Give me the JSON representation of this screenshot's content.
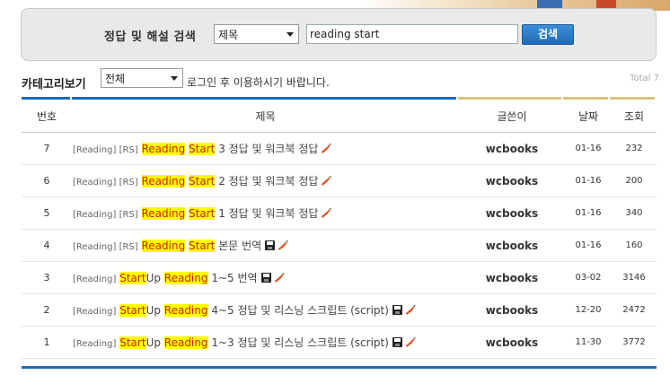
{
  "search": {
    "label": "정답 및 해설 검색",
    "field_selected": "제목",
    "query": "reading start",
    "button_label": "검색"
  },
  "category": {
    "label": "카테고리보기",
    "selected": "전체",
    "login_note": "로그인 후 이용하시기 바랍니다.",
    "total": "Total 7"
  },
  "table": {
    "headers": {
      "num": "번호",
      "title": "제목",
      "writer": "글쓴이",
      "date": "날짜",
      "views": "조회"
    },
    "rows": [
      {
        "num": "7",
        "tag": "[Reading] [RS]",
        "parts": [
          " ",
          "Reading",
          " ",
          "Start",
          " 3 정답 및 워크북 정답"
        ],
        "hl": [
          1,
          3
        ],
        "disk": false,
        "writer": "wcbooks",
        "date": "01-16",
        "views": "232"
      },
      {
        "num": "6",
        "tag": "[Reading] [RS]",
        "parts": [
          " ",
          "Reading",
          " ",
          "Start",
          " 2 정답 및 워크북 정답"
        ],
        "hl": [
          1,
          3
        ],
        "disk": false,
        "writer": "wcbooks",
        "date": "01-16",
        "views": "200"
      },
      {
        "num": "5",
        "tag": "[Reading] [RS]",
        "parts": [
          " ",
          "Reading",
          " ",
          "Start",
          " 1 정답 및 워크북 정답"
        ],
        "hl": [
          1,
          3
        ],
        "disk": false,
        "writer": "wcbooks",
        "date": "01-16",
        "views": "340"
      },
      {
        "num": "4",
        "tag": "[Reading] [RS]",
        "parts": [
          " ",
          "Reading",
          " ",
          "Start",
          " 본문 번역"
        ],
        "hl": [
          1,
          3
        ],
        "disk": true,
        "writer": "wcbooks",
        "date": "01-16",
        "views": "160"
      },
      {
        "num": "3",
        "tag": "[Reading]",
        "parts": [
          " ",
          "Start",
          "Up ",
          "Reading",
          " 1~5 번역"
        ],
        "hl": [
          1,
          3
        ],
        "disk": true,
        "writer": "wcbooks",
        "date": "03-02",
        "views": "3146"
      },
      {
        "num": "2",
        "tag": "[Reading]",
        "parts": [
          " ",
          "Start",
          "Up ",
          "Reading",
          " 4~5 정답 및 리스닝 스크립트 (script)"
        ],
        "hl": [
          1,
          3
        ],
        "disk": true,
        "writer": "wcbooks",
        "date": "12-20",
        "views": "2472"
      },
      {
        "num": "1",
        "tag": "[Reading]",
        "parts": [
          " ",
          "Start",
          "Up ",
          "Reading",
          " 1~3 정답 및 리스닝 스크립트 (script)"
        ],
        "hl": [
          1,
          3
        ],
        "disk": true,
        "writer": "wcbooks",
        "date": "11-30",
        "views": "3772"
      }
    ]
  },
  "colors": {
    "accent_blue": "#1f6bb8",
    "accent_gold": "#d8c27a",
    "highlight_bg": "#ffff00",
    "highlight_text": "#cc2200"
  },
  "icons": {
    "disk": "floppy-disk-icon",
    "new": "pepper-icon"
  }
}
